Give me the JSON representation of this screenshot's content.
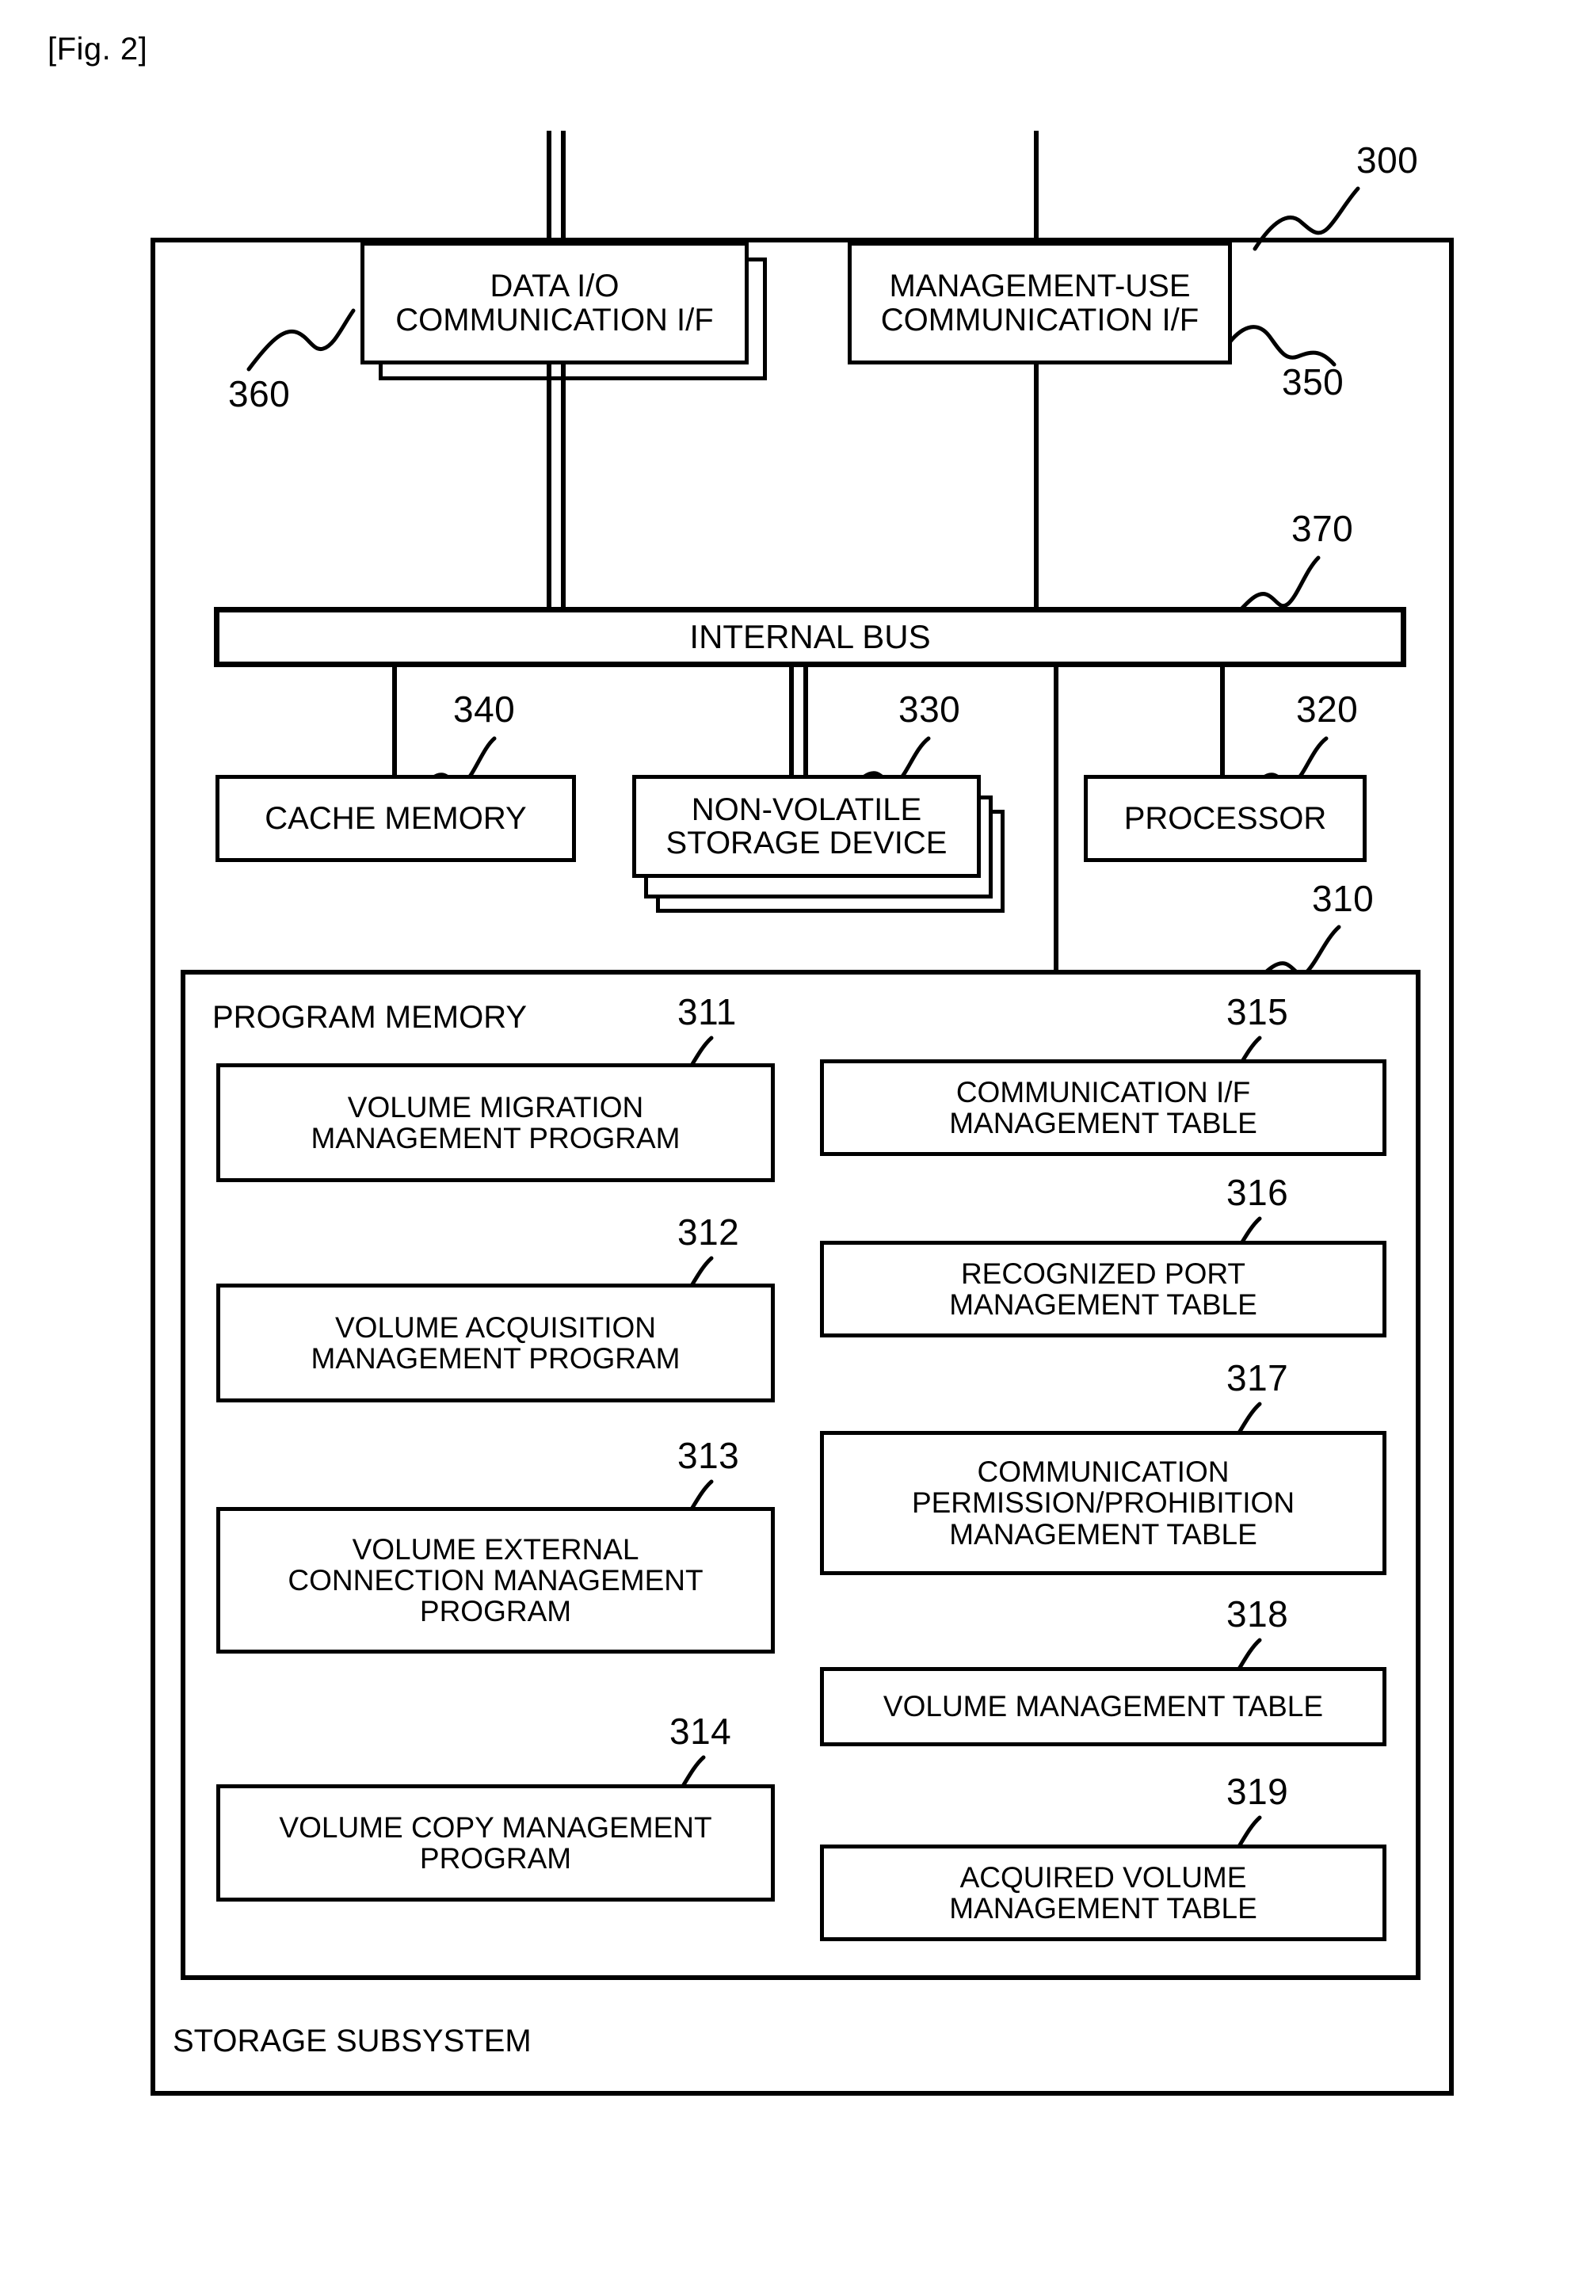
{
  "figure": {
    "label": "[Fig. 2]",
    "caption_bottom": "STORAGE SUBSYSTEM"
  },
  "refs": {
    "storage_subsystem": "300",
    "program_memory": "310",
    "volume_migration_program": "311",
    "volume_acquisition_program": "312",
    "volume_external_connection_program": "313",
    "volume_copy_program": "314",
    "communication_if_table": "315",
    "recognized_port_table": "316",
    "communication_permission_table": "317",
    "volume_management_table": "318",
    "acquired_volume_table": "319",
    "processor": "320",
    "non_volatile_storage_device": "330",
    "cache_memory": "340",
    "management_use_communication_if": "350",
    "data_io_communication_if": "360",
    "internal_bus": "370"
  },
  "blocks": {
    "data_io_if": {
      "line1": "DATA I/O",
      "line2": "COMMUNICATION I/F"
    },
    "management_if": {
      "line1": "MANAGEMENT-USE",
      "line2": "COMMUNICATION I/F"
    },
    "internal_bus": {
      "label": "INTERNAL BUS"
    },
    "cache_memory": {
      "label": "CACHE MEMORY"
    },
    "non_volatile": {
      "line1": "NON-VOLATILE",
      "line2": "STORAGE DEVICE"
    },
    "processor": {
      "label": "PROCESSOR"
    },
    "program_memory": {
      "title": "PROGRAM MEMORY"
    }
  },
  "programs": [
    {
      "ref": "311",
      "line1": "VOLUME MIGRATION",
      "line2": "MANAGEMENT PROGRAM",
      "line3": ""
    },
    {
      "ref": "312",
      "line1": "VOLUME ACQUISITION",
      "line2": "MANAGEMENT PROGRAM",
      "line3": ""
    },
    {
      "ref": "313",
      "line1": "VOLUME EXTERNAL",
      "line2": "CONNECTION MANAGEMENT",
      "line3": "PROGRAM"
    },
    {
      "ref": "314",
      "line1": "VOLUME COPY MANAGEMENT",
      "line2": "PROGRAM",
      "line3": ""
    }
  ],
  "tables": [
    {
      "ref": "315",
      "line1": "COMMUNICATION I/F",
      "line2": "MANAGEMENT TABLE",
      "line3": ""
    },
    {
      "ref": "316",
      "line1": "RECOGNIZED PORT",
      "line2": "MANAGEMENT TABLE",
      "line3": ""
    },
    {
      "ref": "317",
      "line1": "COMMUNICATION",
      "line2": "PERMISSION/PROHIBITION",
      "line3": "MANAGEMENT TABLE"
    },
    {
      "ref": "318",
      "line1": "VOLUME MANAGEMENT TABLE",
      "line2": "",
      "line3": ""
    },
    {
      "ref": "319",
      "line1": "ACQUIRED VOLUME",
      "line2": "MANAGEMENT TABLE",
      "line3": ""
    }
  ],
  "colors": {
    "line": "#000000",
    "background": "#ffffff"
  }
}
